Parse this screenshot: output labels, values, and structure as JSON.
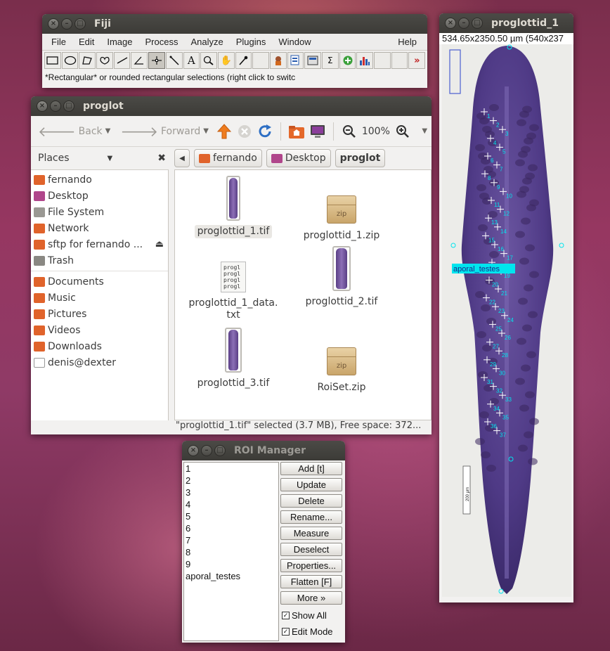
{
  "fiji": {
    "title": "Fiji",
    "menus": [
      "File",
      "Edit",
      "Image",
      "Process",
      "Analyze",
      "Plugins",
      "Window",
      "Help"
    ],
    "tools": [
      "rectangle-select",
      "oval-select",
      "polygon-select",
      "freehand-select",
      "line",
      "angle",
      "point",
      "wand",
      "text",
      "magnifier",
      "hand",
      "color-picker",
      "",
      "developer-menu",
      "stacks",
      "lut",
      "sigma",
      "plus-circle",
      "bar-chart",
      "",
      "more-tools"
    ],
    "status": "*Rectangular* or rounded rectangular selections (right click to switc"
  },
  "file_manager": {
    "title": "proglot",
    "back_label": "Back",
    "forward_label": "Forward",
    "zoom": "100%",
    "places_label": "Places",
    "places": [
      {
        "label": "fernando",
        "icon": "home-folder-icon",
        "color": "#e0632b"
      },
      {
        "label": "Desktop",
        "icon": "desktop-icon",
        "color": "#b0468b"
      },
      {
        "label": "File System",
        "icon": "drive-icon",
        "color": "#9a9893"
      },
      {
        "label": "Network",
        "icon": "network-icon",
        "color": "#e0632b"
      },
      {
        "label": "sftp for fernando ...",
        "icon": "remote-folder-icon",
        "color": "#e0632b"
      },
      {
        "label": "Trash",
        "icon": "trash-icon",
        "color": "#8a8883"
      }
    ],
    "bookmarks": [
      {
        "label": "Documents",
        "icon": "documents-folder-icon",
        "color": "#e0632b"
      },
      {
        "label": "Music",
        "icon": "music-folder-icon",
        "color": "#e0632b"
      },
      {
        "label": "Pictures",
        "icon": "pictures-folder-icon",
        "color": "#e0632b"
      },
      {
        "label": "Videos",
        "icon": "videos-folder-icon",
        "color": "#e0632b"
      },
      {
        "label": "Downloads",
        "icon": "downloads-folder-icon",
        "color": "#e0632b"
      },
      {
        "label": "denis@dexter",
        "icon": "network-share-icon",
        "color": "#cfcfcf"
      }
    ],
    "crumbs": [
      "fernando",
      "Desktop",
      "proglot"
    ],
    "files": [
      {
        "name": "proglottid_1.tif",
        "kind": "image",
        "selected": true
      },
      {
        "name": "proglottid_1.zip",
        "kind": "zip"
      },
      {
        "name": "proglottid_1_data.\ntxt",
        "kind": "text"
      },
      {
        "name": "proglottid_2.tif",
        "kind": "image"
      },
      {
        "name": "proglottid_3.tif",
        "kind": "image"
      },
      {
        "name": "RoiSet.zip",
        "kind": "zip"
      }
    ],
    "text_preview": "progl\nprogl\nprogl\nprogl",
    "status": "\"proglottid_1.tif\" selected (3.7 MB), Free space: 372..."
  },
  "roi_manager": {
    "title": "ROI Manager",
    "rois": [
      "1",
      "2",
      "3",
      "4",
      "5",
      "6",
      "7",
      "8",
      "9",
      "aporal_testes"
    ],
    "buttons": [
      "Add [t]",
      "Update",
      "Delete",
      "Rename...",
      "Measure",
      "Deselect",
      "Properties...",
      "Flatten [F]",
      "More »"
    ],
    "show_all": "Show All",
    "edit_mode": "Edit Mode"
  },
  "image_window": {
    "title": "proglottid_1",
    "info": "534.65x2350.50 µm (540x237",
    "roi_label": "aporal_testes",
    "scale_label": "200 µm",
    "point_labels": [
      "1",
      "2",
      "3",
      "4",
      "5",
      "6",
      "7",
      "8",
      "9",
      "10",
      "11",
      "12",
      "13",
      "14",
      "15",
      "16",
      "17",
      "18",
      "19",
      "20",
      "21",
      "22",
      "23",
      "24",
      "25",
      "26",
      "27",
      "28",
      "29",
      "30",
      "31",
      "32",
      "33",
      "34",
      "35",
      "36",
      "37"
    ],
    "accent": "#00e5ee",
    "worm_color": "#4f3a86"
  }
}
